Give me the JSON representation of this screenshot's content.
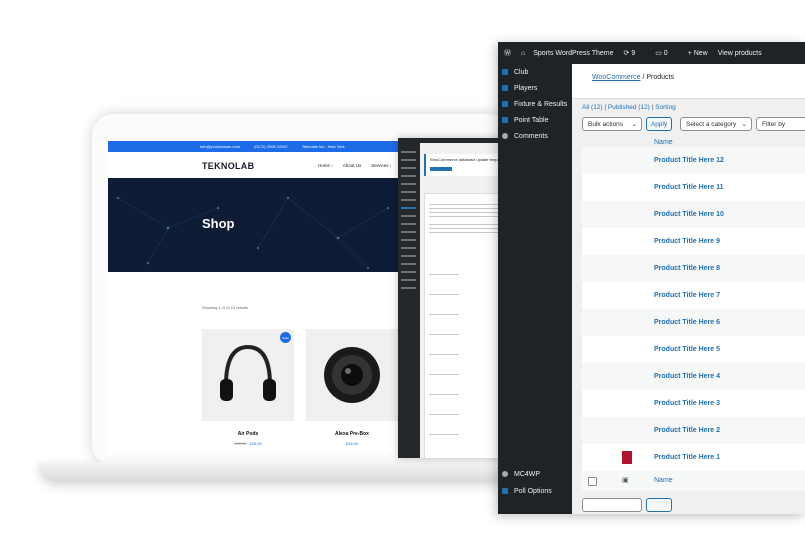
{
  "laptop_site": {
    "topbar": {
      "email": "info@yourdomain.com",
      "phone": "(0172) 2008 22047",
      "address": "Teknolab Inc., New York"
    },
    "logo": "TEKNOLAB",
    "nav": [
      "Home ›",
      "About Us",
      "Services ›"
    ],
    "hero_title": "Shop",
    "showing_text": "Showing 1–9 of 12 results",
    "products": [
      {
        "name": "Air Pods",
        "old_price": "£35.00",
        "price": "£25.00",
        "badge": "Sale!"
      },
      {
        "name": "Alexa Pre-Box",
        "price": "£25.00"
      }
    ]
  },
  "editor": {
    "notice_title": "WooCommerce database update required"
  },
  "wp_admin": {
    "admin_bar": {
      "site_name": "Sports WordPress Theme",
      "updates": "9",
      "comments": "0",
      "new": "+ New",
      "view": "View products"
    },
    "sidebar": [
      "Club",
      "Players",
      "Fixture & Results",
      "Point Table",
      "Comments"
    ],
    "sidebar_bottom": [
      "MC4WP",
      "Poll Options"
    ],
    "breadcrumb": {
      "parent": "WooCommerce",
      "sep": "/",
      "current": "Products"
    },
    "filters": {
      "all": "All (12)",
      "sep1": "|",
      "published": "Published (12)",
      "sep2": "|",
      "sorting": "Sorting"
    },
    "bulk_actions": "Bulk actions",
    "apply": "Apply",
    "category": "Select a category",
    "filter_by": "Filter by",
    "name_header": "Name",
    "rows": [
      "Product Title Here 12",
      "Product Title Here 11",
      "Product Title Here 10",
      "Product Title Here 9",
      "Product Title Here 8",
      "Product Title Here 7",
      "Product Title Here 6",
      "Product Title Here 5",
      "Product Title Here 4",
      "Product Title Here 3",
      "Product Title Here 2",
      "Product Title Here 1"
    ],
    "name_footer": "Name"
  },
  "colors": {
    "wp_dark": "#1d2327",
    "wp_link": "#2271b1",
    "site_blue": "#1d6be6",
    "hero_bg": "#0e1c36"
  }
}
